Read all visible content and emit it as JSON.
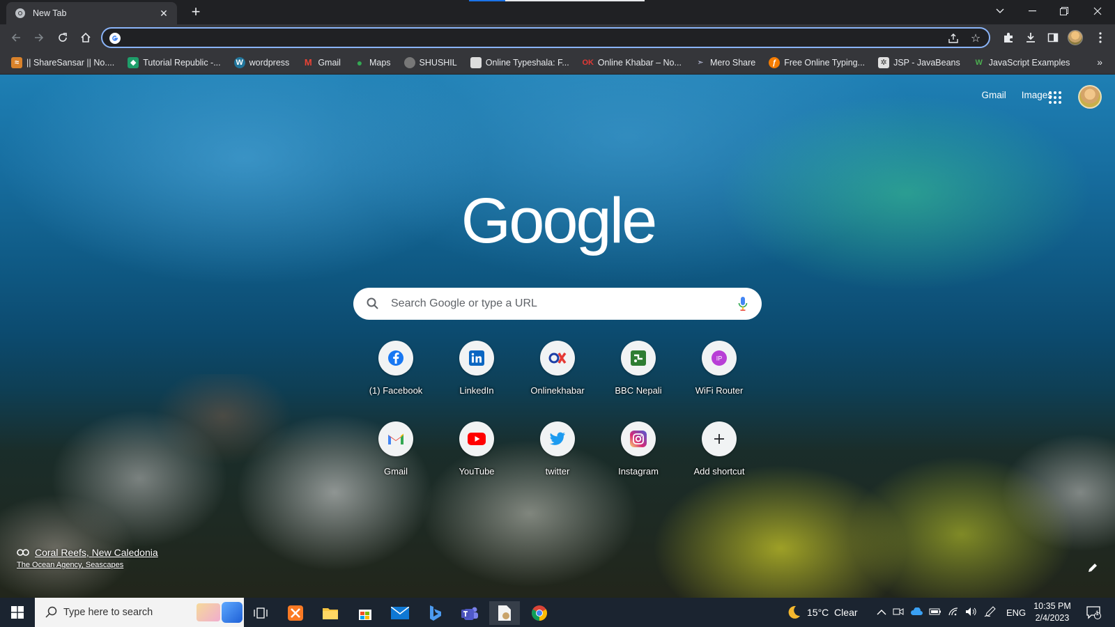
{
  "tab": {
    "title": "New Tab"
  },
  "toolbar": {
    "omnibox_value": ""
  },
  "bookmarks": [
    {
      "label": "|| ShareSansar || No....",
      "icon": "sharesansar-icon",
      "color": "#d9822b"
    },
    {
      "label": "Tutorial Republic -...",
      "icon": "tutorialrepublic-icon",
      "color": "#1e9e6a"
    },
    {
      "label": "wordpress",
      "icon": "wordpress-icon",
      "color": "#21759b"
    },
    {
      "label": "Gmail",
      "icon": "gmail-icon",
      "color": "#ea4335"
    },
    {
      "label": "Maps",
      "icon": "maps-icon",
      "color": "#34a853"
    },
    {
      "label": "SHUSHIL",
      "icon": "profile-photo-icon",
      "color": "#777777"
    },
    {
      "label": "Online Typeshala: F...",
      "icon": "document-icon",
      "color": "#dddddd"
    },
    {
      "label": "Online Khabar – No...",
      "icon": "onlinekhabar-icon",
      "color": "#e53935"
    },
    {
      "label": "Mero Share",
      "icon": "meroshare-icon",
      "color": "#5c6bc0"
    },
    {
      "label": "Free Online Typing...",
      "icon": "typing-icon",
      "color": "#f57c00"
    },
    {
      "label": "JSP - JavaBeans",
      "icon": "javatpoint-icon",
      "color": "#e0e0e0"
    },
    {
      "label": "JavaScript Examples",
      "icon": "w3-icon",
      "color": "#4caf50"
    }
  ],
  "ntp": {
    "gmail_link": "Gmail",
    "images_link": "Images",
    "logo_text": "Google",
    "search_placeholder": "Search Google or type a URL",
    "shortcuts": [
      {
        "label": "(1) Facebook",
        "icon": "facebook-icon"
      },
      {
        "label": "LinkedIn",
        "icon": "linkedin-icon"
      },
      {
        "label": "Onlinekhabar",
        "icon": "onlinekhabar-icon"
      },
      {
        "label": "BBC Nepali",
        "icon": "bbc-nepali-icon"
      },
      {
        "label": "WiFi Router",
        "icon": "router-ip-icon"
      },
      {
        "label": "Gmail",
        "icon": "gmail-icon"
      },
      {
        "label": "YouTube",
        "icon": "youtube-icon"
      },
      {
        "label": "twitter",
        "icon": "twitter-icon"
      },
      {
        "label": "Instagram",
        "icon": "instagram-icon"
      },
      {
        "label": "Add shortcut",
        "icon": "plus-icon"
      }
    ],
    "attribution_title": "Coral Reefs, New Caledonia",
    "attribution_credit": "The Ocean Agency, Seascapes"
  },
  "taskbar": {
    "search_placeholder": "Type here to search",
    "weather": "15°C  Clear",
    "language": "ENG",
    "time": "10:35 PM",
    "date": "2/4/2023",
    "notification_count": "1"
  },
  "colors": {
    "accent": "#8ab4f8",
    "chrome_dark": "#202124",
    "toolbar": "#35363a"
  }
}
